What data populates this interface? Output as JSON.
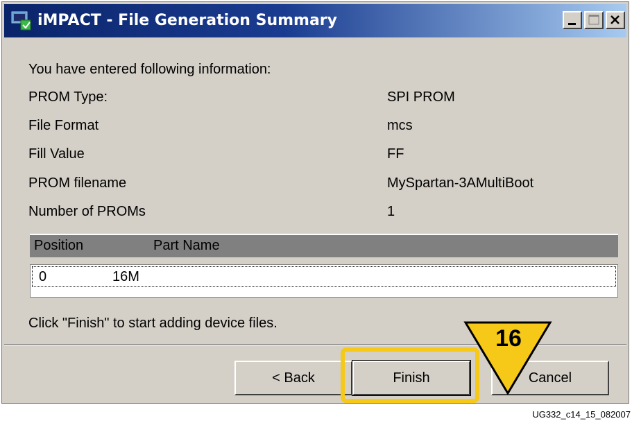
{
  "window": {
    "title": "iMPACT - File Generation Summary",
    "app_icon": "impact-app-icon",
    "controls": [
      "minimize-icon",
      "maximize-icon",
      "close-icon"
    ]
  },
  "summary": {
    "intro": "You have entered following information:",
    "fields": [
      {
        "label": "PROM Type:",
        "value": "SPI PROM"
      },
      {
        "label": "File Format",
        "value": "mcs"
      },
      {
        "label": "Fill Value",
        "value": "FF"
      },
      {
        "label": "PROM filename",
        "value": "MySpartan-3AMultiBoot"
      },
      {
        "label": "Number of PROMs",
        "value": "1"
      }
    ]
  },
  "prom_table": {
    "headers": [
      "Position",
      "Part Name"
    ],
    "rows": [
      {
        "position": "0",
        "part_name": "16M"
      }
    ]
  },
  "instruction": "Click \"Finish\" to start adding device files.",
  "buttons": {
    "back": "< Back",
    "finish": "Finish",
    "cancel": "Cancel"
  },
  "callout": {
    "number": "16",
    "color": "#f6c817"
  },
  "figure_id": "UG332_c14_15_082007"
}
